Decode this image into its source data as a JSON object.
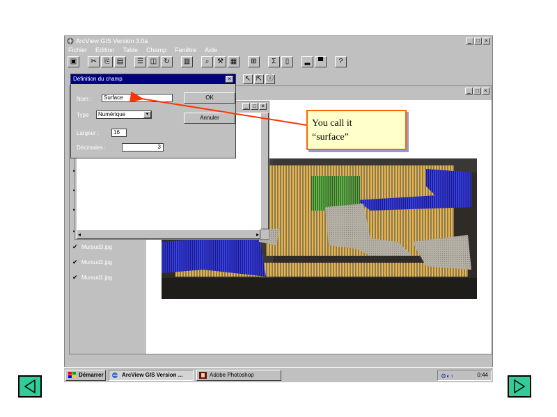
{
  "app": {
    "title": "ArcView GIS Version 3.0a",
    "menu": [
      "Fichier",
      "Edition",
      "Table",
      "Champ",
      "Fenêtre",
      "Aide"
    ]
  },
  "dialog": {
    "title": "Définition du champ",
    "name_label": "Nom :",
    "name_value": "Surface",
    "type_label": "Type",
    "type_value": "Numérique",
    "width_label": "Largeur :",
    "width_value": "16",
    "decimals_label": "Décimales :",
    "decimals_value": "3",
    "ok_label": "OK",
    "cancel_label": "Annuler"
  },
  "layers": [
    "Mursud3.jpg",
    "Mursud2.jpg",
    "Mursud1.jpg"
  ],
  "callout": {
    "line1": "You call it",
    "line2": "“surface”"
  },
  "taskbar": {
    "start_label": "Démarrer",
    "task1": "ArcView GIS Version ...",
    "task2": "Adobe Photoshop",
    "clock": "0:44"
  },
  "colors": {
    "callout_border": "#ff6600",
    "callout_bg": "#ffffcc",
    "nav_button": "#33cc99",
    "arrow": "#ff3300"
  }
}
